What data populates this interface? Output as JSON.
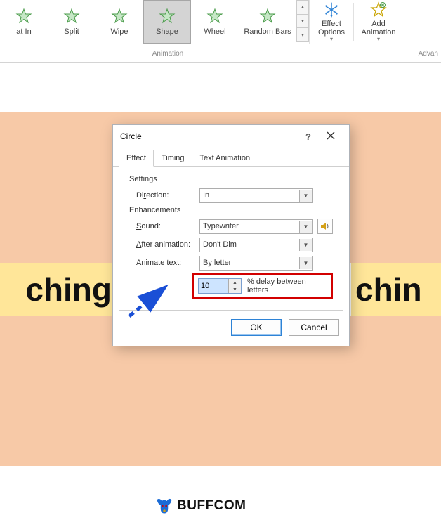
{
  "ribbon": {
    "animations": [
      {
        "label": "at In"
      },
      {
        "label": "Split"
      },
      {
        "label": "Wipe"
      },
      {
        "label": "Shape",
        "selected": true
      },
      {
        "label": "Wheel"
      },
      {
        "label": "Random Bars"
      }
    ],
    "group_anim_label": "Animation",
    "effect_options": "Effect\nOptions",
    "add_animation": "Add\nAnimation",
    "group_adv_label": "Advan"
  },
  "slide": {
    "left_text": "ching",
    "right_text": "chin"
  },
  "dialog": {
    "title": "Circle",
    "tab_effect": "Effect",
    "tab_timing": "Timing",
    "tab_textanim": "Text Animation",
    "sec_settings": "Settings",
    "direction_label_pre": "Di",
    "direction_label_u": "r",
    "direction_label_post": "ection:",
    "direction_value": "In",
    "sec_enh": "Enhancements",
    "sound_label_u": "S",
    "sound_label_post": "ound:",
    "sound_value": "Typewriter",
    "after_label_u": "A",
    "after_label_post": "fter animation:",
    "after_value": "Don't Dim",
    "animtext_label_pre": "Animate te",
    "animtext_label_u": "x",
    "animtext_label_post": "t:",
    "animtext_value": "By letter",
    "delay_value": "10",
    "delay_label_pre": "% ",
    "delay_label_u": "d",
    "delay_label_post": "elay between letters",
    "ok": "OK",
    "cancel": "Cancel"
  },
  "logo_text": "BUFFCOM"
}
